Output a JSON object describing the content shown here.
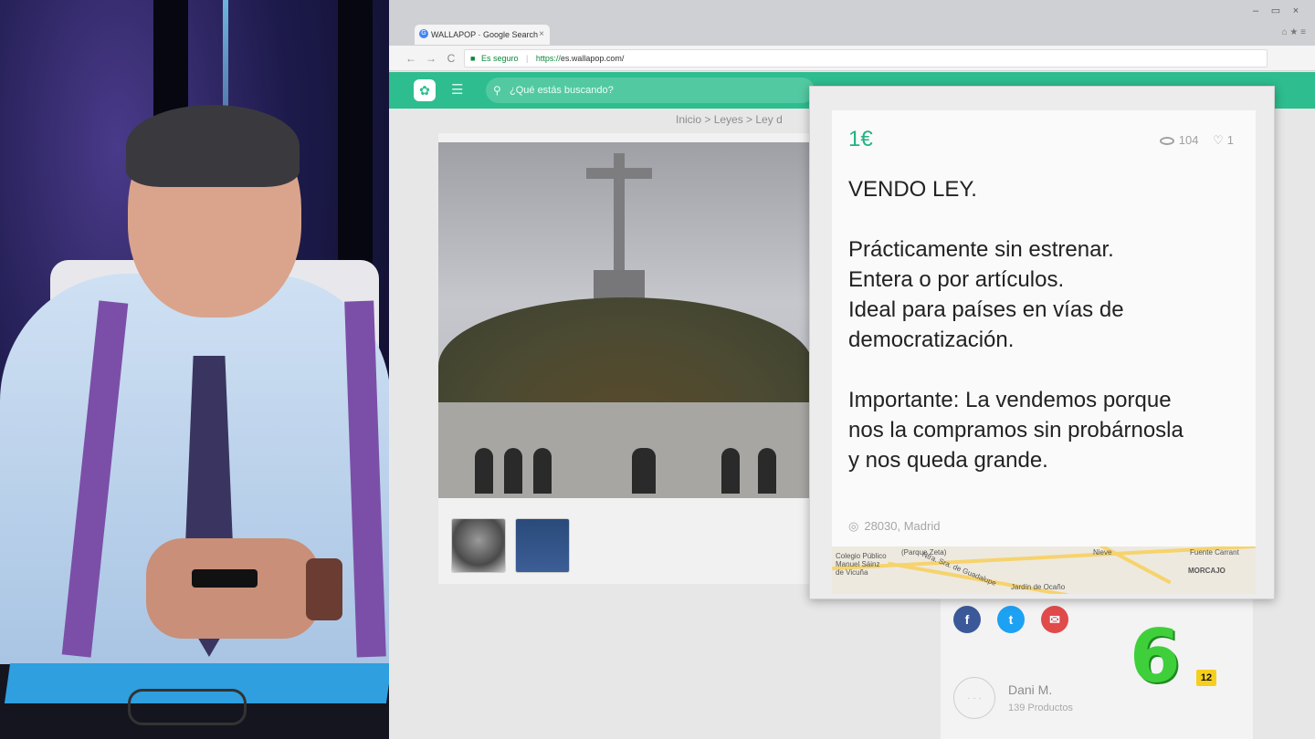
{
  "browser": {
    "tab_title": "WALLAPOP · Google Search",
    "tab_favicon": "G",
    "tab_close": "×",
    "window_minimize": "–",
    "window_restore": "▭",
    "window_close": "×",
    "back": "←",
    "forward": "→",
    "reload": "C",
    "secure_label": "Es seguro",
    "url_scheme": "https://",
    "url_host": "es.wallapop.com/",
    "actions": "⌂ ★ ≡"
  },
  "site": {
    "search_placeholder": "¿Qué estás buscando?",
    "search_icon": "⚲",
    "logo_icon": "✿",
    "category_icon": "☰",
    "breadcrumb": "Inicio > Leyes > Ley d",
    "accent": "#2ebd8e"
  },
  "listing": {
    "price": "1€",
    "views": "104",
    "likes": "1",
    "heart_icon": "♡",
    "pin_icon": "◎",
    "description": [
      "VENDO LEY.",
      "",
      "Prácticamente sin estrenar.",
      "Entera o por artículos.",
      "Ideal para países en vías de",
      "democratización.",
      "",
      "Importante: La vendemos porque",
      "nos la compramos sin probárnosla",
      "y nos queda grande."
    ],
    "location": "28030, Madrid"
  },
  "map_labels": {
    "school": "Colegio Público\nManuel Sáinz\nde Vicuña",
    "park": "(Parque Zeta)",
    "street": "Ntra. Sra. de Guadalupe",
    "garden": "Jardín de Ocaño",
    "neighborhood": "MORCAJO",
    "fountain": "Fuente Carrant",
    "station": "Nieve"
  },
  "share": {
    "facebook": "f",
    "twitter": "t",
    "email": "✉"
  },
  "seller": {
    "avatar": "· · ·",
    "name": "Dani M.",
    "products": "139 Productos"
  },
  "channel": {
    "logo": "6",
    "badge": "12"
  }
}
